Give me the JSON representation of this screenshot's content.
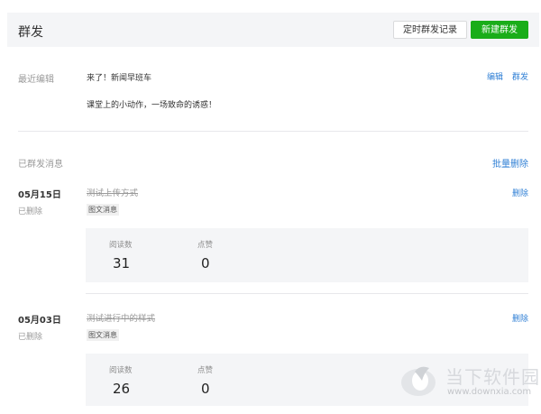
{
  "header": {
    "title": "群发",
    "schedule_button": "定时群发记录",
    "new_button": "新建群发"
  },
  "recent": {
    "label": "最近编辑",
    "line1": "来了！新闻早班车",
    "line2": "课堂上的小动作，一场致命的诱惑！",
    "edit_link": "编辑",
    "send_link": "群发"
  },
  "sent": {
    "label": "已群发消息",
    "bulk_delete": "批量删除",
    "messages": [
      {
        "date": "05月15日",
        "status": "已删除",
        "title": "测试上传方式",
        "type": "图文消息",
        "reads_label": "阅读数",
        "reads": "31",
        "likes_label": "点赞",
        "likes": "0",
        "delete_label": "删除"
      },
      {
        "date": "05月03日",
        "status": "已删除",
        "title": "测试进行中的样式",
        "type": "图文消息",
        "reads_label": "阅读数",
        "reads": "26",
        "likes_label": "点赞",
        "likes": "0",
        "delete_label": "删除"
      }
    ]
  },
  "watermark": {
    "name": "当下软件园",
    "url": "www.downxia.com"
  },
  "colors": {
    "primary_green": "#1aad19",
    "link_blue": "#2f7fd5",
    "panel_gray": "#f4f5f7"
  }
}
